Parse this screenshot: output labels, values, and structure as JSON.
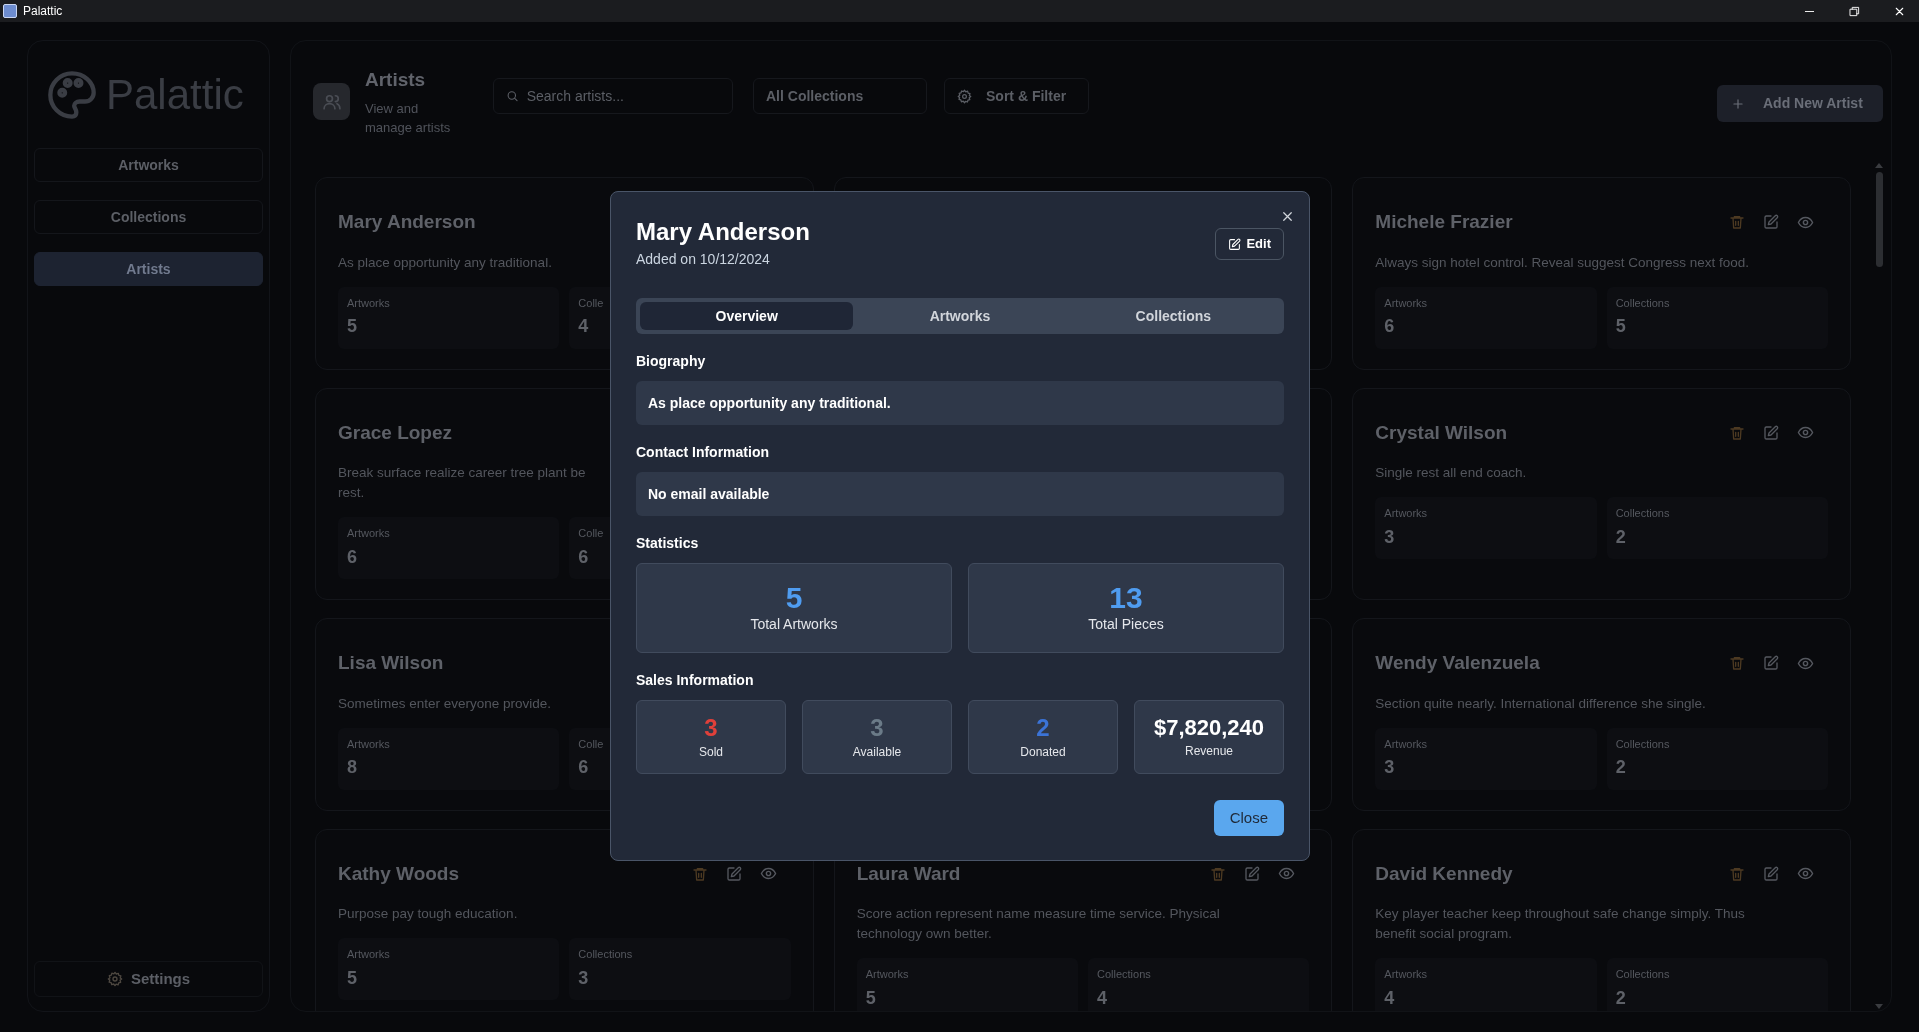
{
  "window": {
    "title": "Palattic"
  },
  "sidebar": {
    "logo": "Palattic",
    "items": [
      {
        "label": "Artworks",
        "selected": false
      },
      {
        "label": "Collections",
        "selected": false
      },
      {
        "label": "Artists",
        "selected": true
      }
    ],
    "settings": "Settings"
  },
  "header": {
    "title": "Artists",
    "subtitle": "View and manage artists",
    "search": {
      "placeholder": "Search artists..."
    },
    "collections_select": "All Collections",
    "sort_button": "Sort & Filter",
    "add_button": "Add New Artist"
  },
  "rows": [
    [
      {
        "name": "Mary Anderson",
        "description": [
          "As place opportunity any traditional."
        ],
        "stats": [
          {
            "label": "Artworks",
            "value": "5"
          },
          {
            "label": "Colle",
            "value": "4"
          }
        ]
      },
      null,
      {
        "name": "Michele Frazier",
        "description": [
          "Always sign hotel control. Reveal suggest Congress next food."
        ],
        "stats": [
          {
            "label": "Artworks",
            "value": "6"
          },
          {
            "label": "Collections",
            "value": "5"
          }
        ]
      }
    ],
    [
      {
        "name": "Grace Lopez",
        "description": [
          "Break surface realize career tree plant be",
          "rest."
        ],
        "stats": [
          {
            "label": "Artworks",
            "value": "6"
          },
          {
            "label": "Colle",
            "value": "6"
          }
        ]
      },
      null,
      {
        "name": "Crystal Wilson",
        "description": [
          "Single rest all end coach."
        ],
        "stats": [
          {
            "label": "Artworks",
            "value": "3"
          },
          {
            "label": "Collections",
            "value": "2"
          }
        ]
      }
    ],
    [
      {
        "name": "Lisa Wilson",
        "description": [
          "Sometimes enter everyone provide."
        ],
        "stats": [
          {
            "label": "Artworks",
            "value": "8"
          },
          {
            "label": "Colle",
            "value": "6"
          }
        ]
      },
      null,
      {
        "name": "Wendy Valenzuela",
        "description": [
          "Section quite nearly. International difference she single."
        ],
        "stats": [
          {
            "label": "Artworks",
            "value": "3"
          },
          {
            "label": "Collections",
            "value": "2"
          }
        ]
      }
    ],
    [
      {
        "name": "Kathy Woods",
        "description": [
          "Purpose pay tough education."
        ],
        "stats": [
          {
            "label": "Artworks",
            "value": "5"
          },
          {
            "label": "Collections",
            "value": "3"
          }
        ]
      },
      {
        "name": "Laura Ward",
        "description": [
          "Score action represent name measure time service. Physical",
          "technology own better."
        ],
        "stats": [
          {
            "label": "Artworks",
            "value": "5"
          },
          {
            "label": "Collections",
            "value": "4"
          }
        ]
      },
      {
        "name": "David Kennedy",
        "description": [
          "Key player teacher keep throughout safe change simply. Thus",
          "benefit social program."
        ],
        "stats": [
          {
            "label": "Artworks",
            "value": "4"
          },
          {
            "label": "Collections",
            "value": "2"
          }
        ]
      }
    ]
  ],
  "modal": {
    "title": "Mary Anderson",
    "added": "Added on 10/12/2024",
    "edit_button": "Edit",
    "tabs": [
      {
        "label": "Overview",
        "selected": true
      },
      {
        "label": "Artworks",
        "selected": false
      },
      {
        "label": "Collections",
        "selected": false
      }
    ],
    "biography_heading": "Biography",
    "biography": "As place opportunity any traditional.",
    "contact_heading": "Contact Information",
    "contact": "No email available",
    "statistics_heading": "Statistics",
    "statistics": [
      {
        "value": "5",
        "label": "Total Artworks",
        "color": "#4f9cf0"
      },
      {
        "value": "13",
        "label": "Total Pieces",
        "color": "#4f9cf0"
      }
    ],
    "sales_heading": "Sales Information",
    "sales": [
      {
        "value": "3",
        "label": "Sold",
        "color": "#e0403a"
      },
      {
        "value": "3",
        "label": "Available",
        "color": "#6b7b88"
      },
      {
        "value": "2",
        "label": "Donated",
        "color": "#3b73d6"
      },
      {
        "value": "$7,820,240",
        "label": "Revenue",
        "color": "#ffffff"
      }
    ],
    "close_button": "Close"
  }
}
